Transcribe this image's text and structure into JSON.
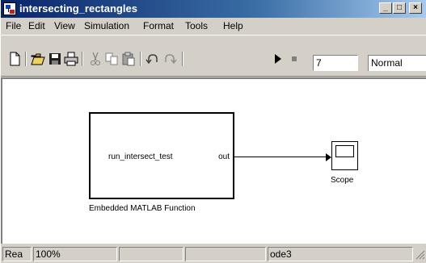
{
  "window": {
    "title": "intersecting_rectangles",
    "controls": {
      "minimize": "_",
      "maximize": "□",
      "close": "×"
    }
  },
  "menu": [
    "File",
    "Edit",
    "View",
    "Simulation",
    "Format",
    "Tools",
    "Help"
  ],
  "toolbar": {
    "icons": [
      "new-icon",
      "open-icon",
      "save-icon",
      "print-icon",
      "cut-icon",
      "copy-icon",
      "paste-icon",
      "undo-icon",
      "redo-icon",
      "play-icon",
      "stop-icon"
    ],
    "stop_time": "7",
    "sim_mode": "Normal"
  },
  "canvas": {
    "eml_block": {
      "function_name": "run_intersect_test",
      "out_port": "out",
      "label": "Embedded MATLAB Function"
    },
    "scope_block": {
      "label": "Scope"
    }
  },
  "status": {
    "state": "Rea",
    "zoom": "100%",
    "field3": "",
    "field4": "",
    "solver": "ode3"
  }
}
